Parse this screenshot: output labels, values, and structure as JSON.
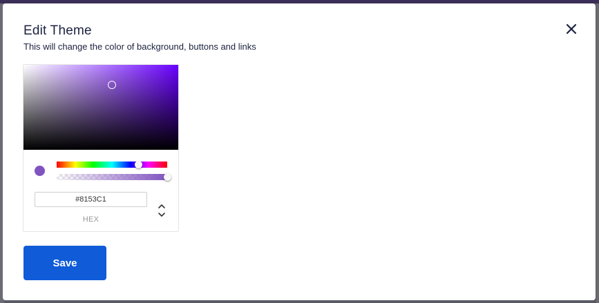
{
  "modal": {
    "title": "Edit Theme",
    "subtitle": "This will change the color of background, buttons and links",
    "close_icon": "close-icon"
  },
  "color_picker": {
    "hex_value": "#8153C1",
    "hex_label": "HEX",
    "selected_color": "#8153C1",
    "hue_color": "#6a00ff",
    "hue_position_fraction": 0.74,
    "alpha_fraction": 1.0,
    "mode_toggle_icon": "chevron-up-down-icon"
  },
  "actions": {
    "save_label": "Save"
  },
  "colors": {
    "accent": "#0f5bd8",
    "title_text": "#1b2240"
  }
}
